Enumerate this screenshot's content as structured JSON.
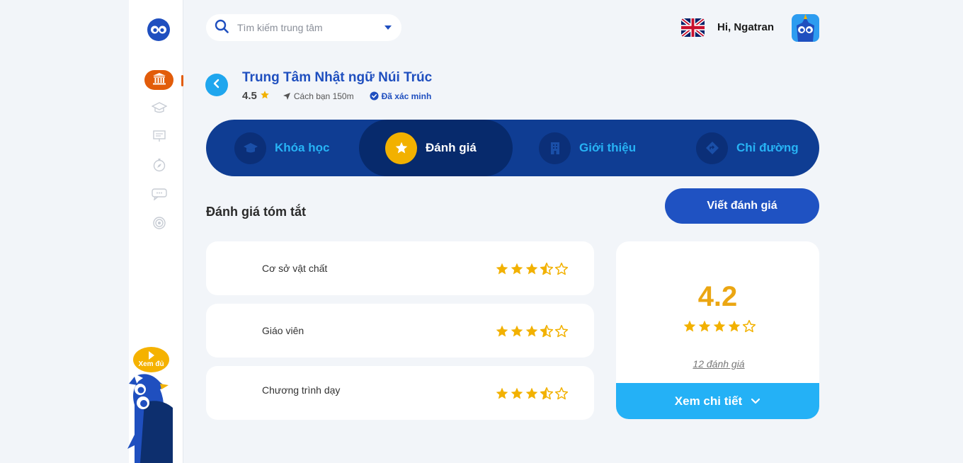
{
  "colors": {
    "primary": "#1f4fbf",
    "accent_orange": "#e25c0a",
    "star": "#f2b100",
    "tab_bg": "#0f3d93",
    "light_blue": "#24b1f6"
  },
  "sidebar": {
    "items": [
      {
        "icon": "institution-icon",
        "active": true
      },
      {
        "icon": "graduation-cap-icon",
        "active": false
      },
      {
        "icon": "presentation-board-icon",
        "active": false
      },
      {
        "icon": "compass-icon",
        "active": false
      },
      {
        "icon": "chat-icon",
        "active": false
      },
      {
        "icon": "target-icon",
        "active": false
      }
    ],
    "mascot_bubble": "Xem đủ"
  },
  "header": {
    "search_placeholder": "Tìm kiếm trung tâm",
    "language_flag": "uk-flag-icon",
    "greeting": "Hi, Ngatran"
  },
  "center": {
    "title": "Trung Tâm Nhật ngữ Núi Trúc",
    "rating": "4.5",
    "distance": "Cách bạn 150m",
    "verified": "Đã xác minh"
  },
  "tabs": [
    {
      "label": "Khóa học",
      "icon": "graduation-cap-icon",
      "active": false
    },
    {
      "label": "Đánh giá",
      "icon": "star-icon",
      "active": true
    },
    {
      "label": "Giới thiệu",
      "icon": "building-icon",
      "active": false
    },
    {
      "label": "Chỉ đường",
      "icon": "direction-icon",
      "active": false
    }
  ],
  "summary": {
    "title": "Đánh giá tóm tắt",
    "write_button": "Viết đánh giá",
    "criteria": [
      {
        "label": "Cơ sở vật chất",
        "stars": 3.5
      },
      {
        "label": "Giáo viên",
        "stars": 3.5
      },
      {
        "label": "Chương trình dạy",
        "stars": 3.5
      }
    ],
    "overall": {
      "score": "4.2",
      "stars": 4,
      "count_label": "12 đánh giá",
      "detail_button": "Xem chi tiết"
    }
  }
}
